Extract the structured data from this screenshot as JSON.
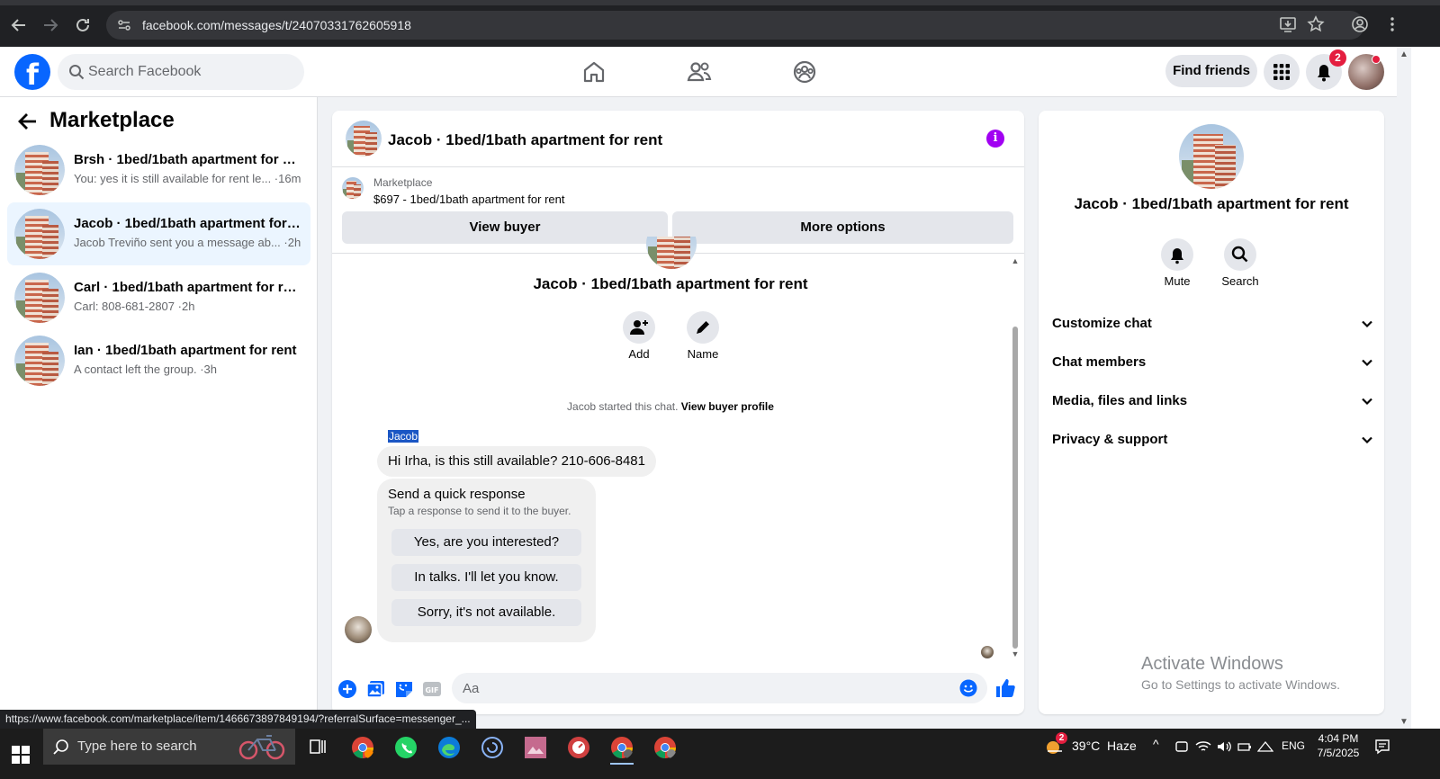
{
  "browser": {
    "url": "facebook.com/messages/t/24070331762605918",
    "status_url": "https://www.facebook.com/marketplace/item/1466673897849194/?referralSurface=messenger_..."
  },
  "fb_header": {
    "search_placeholder": "Search Facebook",
    "find_friends": "Find friends",
    "notification_count": "2",
    "brand_color": "#0866ff"
  },
  "left": {
    "title": "Marketplace",
    "conversations": [
      {
        "name": "Brsh · 1bed/1bath apartment for rent",
        "snippet": "You: yes it is still available for rent le... ·16m",
        "active": false
      },
      {
        "name": "Jacob · 1bed/1bath apartment for r...",
        "snippet": "Jacob Treviño sent you a message ab... ·2h",
        "active": true
      },
      {
        "name": "Carl · 1bed/1bath apartment for rent",
        "snippet": "Carl: 808-681-2807 ·2h",
        "active": false
      },
      {
        "name": "Ian · 1bed/1bath apartment for rent",
        "snippet": "A contact left the group. ·3h",
        "active": false
      }
    ]
  },
  "chat": {
    "title": "Jacob · 1bed/1bath apartment for rent",
    "marketplace_label": "Marketplace",
    "listing": "$697 - 1bed/1bath apartment for rent",
    "view_buyer": "View buyer",
    "more_options": "More options",
    "intro_name": "Jacob · 1bed/1bath apartment for rent",
    "add_label": "Add",
    "name_label": "Name",
    "started_text": "Jacob started this chat.",
    "view_buyer_profile": "View buyer profile",
    "sender_name": "Jacob",
    "message": "Hi Irha, is this still available? 210-606-8481",
    "quick_title": "Send a quick response",
    "quick_sub": "Tap a response to send it to the buyer.",
    "quick_responses": [
      "Yes, are you interested?",
      "In talks. I'll let you know.",
      "Sorry, it's not available."
    ],
    "input_placeholder": "Aa"
  },
  "info": {
    "title": "Jacob · 1bed/1bath apartment for rent",
    "mute_label": "Mute",
    "search_label": "Search",
    "sections": [
      "Customize chat",
      "Chat members",
      "Media, files and links",
      "Privacy & support"
    ],
    "activate_title": "Activate Windows",
    "activate_sub": "Go to Settings to activate Windows."
  },
  "taskbar": {
    "search_placeholder": "Type here to search",
    "weather_badge": "2",
    "weather": "39°C  Haze",
    "lang": "ENG",
    "time": "4:04 PM",
    "date": "7/5/2025"
  }
}
